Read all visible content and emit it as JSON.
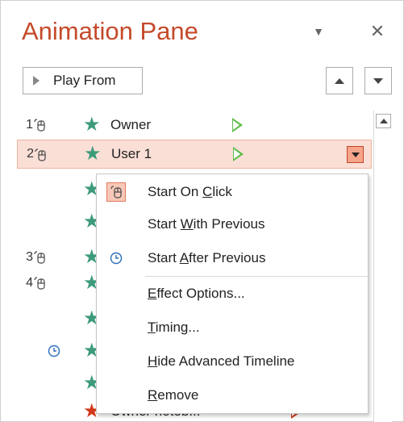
{
  "pane": {
    "title": "Animation Pane",
    "play_button_label": "Play From"
  },
  "list": {
    "rows": [
      {
        "number": "1",
        "name": "Owner",
        "trigger": "on-click",
        "selected": false
      },
      {
        "number": "2",
        "name": "User 1",
        "trigger": "on-click",
        "selected": true
      },
      {
        "number": "",
        "name": "",
        "trigger": "with-previous",
        "selected": false
      },
      {
        "number": "",
        "name": "",
        "trigger": "with-previous",
        "selected": false
      },
      {
        "number": "3",
        "name": "",
        "trigger": "on-click",
        "selected": false
      },
      {
        "number": "4",
        "name": "",
        "trigger": "on-click",
        "selected": false
      },
      {
        "number": "",
        "name": "",
        "trigger": "with-previous",
        "selected": false
      },
      {
        "number": "",
        "name": "",
        "trigger": "after-previous",
        "selected": false
      },
      {
        "number": "",
        "name": "",
        "trigger": "with-previous",
        "selected": false
      },
      {
        "number": "",
        "name": "Owner noteb...",
        "trigger": "with-previous",
        "selected": false
      }
    ]
  },
  "context_menu": {
    "items": [
      {
        "pre": "Start On ",
        "key": "C",
        "post": "lick",
        "icon": "mouse-click-icon",
        "checked": true
      },
      {
        "pre": "Start ",
        "key": "W",
        "post": "ith Previous",
        "icon": "",
        "checked": false
      },
      {
        "pre": "Start ",
        "key": "A",
        "post": "fter Previous",
        "icon": "clock-icon",
        "checked": false
      },
      {
        "pre": "",
        "key": "E",
        "post": "ffect Options...",
        "icon": "",
        "checked": false
      },
      {
        "pre": "",
        "key": "T",
        "post": "iming...",
        "icon": "",
        "checked": false
      },
      {
        "pre": "",
        "key": "H",
        "post": "ide Advanced Timeline",
        "icon": "",
        "checked": false
      },
      {
        "pre": "",
        "key": "R",
        "post": "emove",
        "icon": "",
        "checked": false
      }
    ]
  },
  "colors": {
    "title": "#c44a2a",
    "green_star": "#3d9b7a",
    "red_star": "#d2391b",
    "play_green": "#5fbd4a",
    "selected_row": "#fadfd6",
    "clock_blue": "#2a6ebb"
  }
}
